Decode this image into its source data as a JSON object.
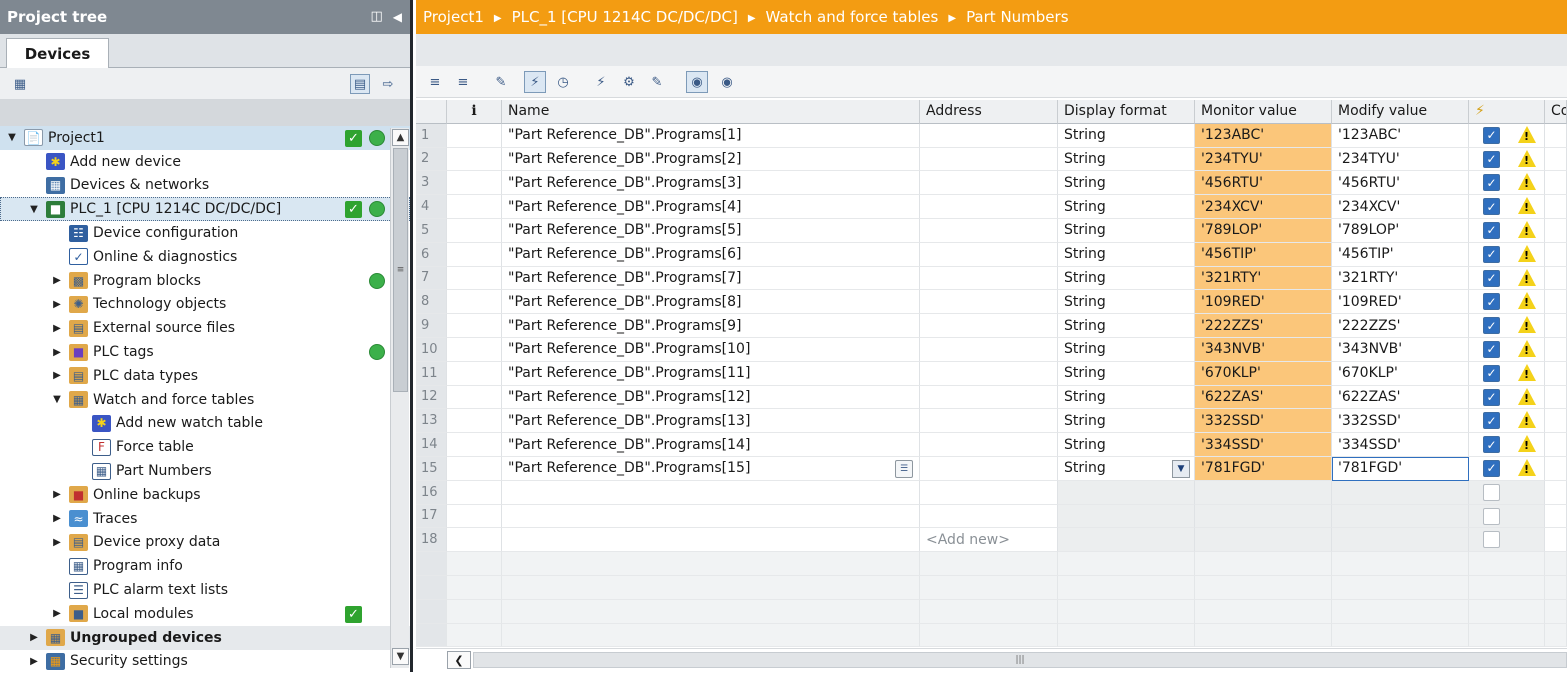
{
  "project_tree": {
    "title": "Project tree",
    "devices_tab": "Devices",
    "items": [
      {
        "label": "Project1",
        "level": 0,
        "expand": "open",
        "icon": "project-icon",
        "status_check": true,
        "status_dot": true,
        "style": "sel"
      },
      {
        "label": "Add new device",
        "level": 1,
        "expand": "",
        "icon": "add-device-icon"
      },
      {
        "label": "Devices & networks",
        "level": 1,
        "expand": "",
        "icon": "network-icon"
      },
      {
        "label": "PLC_1 [CPU 1214C DC/DC/DC]",
        "level": 1,
        "expand": "open",
        "icon": "plc-icon",
        "status_check": true,
        "status_dot": true,
        "style": "selbox"
      },
      {
        "label": "Device configuration",
        "level": 2,
        "expand": "",
        "icon": "device-config-icon"
      },
      {
        "label": "Online & diagnostics",
        "level": 2,
        "expand": "",
        "icon": "diagnostics-icon"
      },
      {
        "label": "Program blocks",
        "level": 2,
        "expand": "closed",
        "icon": "program-blocks-icon",
        "status_dot": true
      },
      {
        "label": "Technology objects",
        "level": 2,
        "expand": "closed",
        "icon": "technology-icon"
      },
      {
        "label": "External source files",
        "level": 2,
        "expand": "closed",
        "icon": "source-files-icon"
      },
      {
        "label": "PLC tags",
        "level": 2,
        "expand": "closed",
        "icon": "tags-icon",
        "status_dot": true
      },
      {
        "label": "PLC data types",
        "level": 2,
        "expand": "closed",
        "icon": "data-types-icon"
      },
      {
        "label": "Watch and force tables",
        "level": 2,
        "expand": "open",
        "icon": "watch-folder-icon"
      },
      {
        "label": "Add new watch table",
        "level": 3,
        "expand": "",
        "icon": "add-watch-icon"
      },
      {
        "label": "Force table",
        "level": 3,
        "expand": "",
        "icon": "force-table-icon"
      },
      {
        "label": "Part Numbers",
        "level": 3,
        "expand": "",
        "icon": "watch-table-icon"
      },
      {
        "label": "Online backups",
        "level": 2,
        "expand": "closed",
        "icon": "backup-icon"
      },
      {
        "label": "Traces",
        "level": 2,
        "expand": "closed",
        "icon": "traces-icon"
      },
      {
        "label": "Device proxy data",
        "level": 2,
        "expand": "closed",
        "icon": "proxy-icon"
      },
      {
        "label": "Program info",
        "level": 2,
        "expand": "",
        "icon": "program-info-icon"
      },
      {
        "label": "PLC alarm text lists",
        "level": 2,
        "expand": "",
        "icon": "alarm-text-icon"
      },
      {
        "label": "Local modules",
        "level": 2,
        "expand": "closed",
        "icon": "modules-icon",
        "status_check": true
      },
      {
        "label": "Ungrouped devices",
        "level": 1,
        "expand": "closed",
        "icon": "ungrouped-icon",
        "style": "grp"
      },
      {
        "label": "Security settings",
        "level": 1,
        "expand": "closed",
        "icon": "security-icon"
      }
    ]
  },
  "breadcrumb": [
    "Project1",
    "PLC_1 [CPU 1214C DC/DC/DC]",
    "Watch and force tables",
    "Part Numbers"
  ],
  "table": {
    "columns": {
      "info": "i",
      "name": "Name",
      "address": "Address",
      "display_format": "Display format",
      "monitor_value": "Monitor value",
      "modify_value": "Modify value",
      "comment": "Co"
    },
    "rows": [
      {
        "num": "1",
        "name": "\"Part Reference_DB\".Programs[1]",
        "format": "String",
        "monitor": "'123ABC'",
        "modify": "'123ABC'"
      },
      {
        "num": "2",
        "name": "\"Part Reference_DB\".Programs[2]",
        "format": "String",
        "monitor": "'234TYU'",
        "modify": "'234TYU'"
      },
      {
        "num": "3",
        "name": "\"Part Reference_DB\".Programs[3]",
        "format": "String",
        "monitor": "'456RTU'",
        "modify": "'456RTU'"
      },
      {
        "num": "4",
        "name": "\"Part Reference_DB\".Programs[4]",
        "format": "String",
        "monitor": "'234XCV'",
        "modify": "'234XCV'"
      },
      {
        "num": "5",
        "name": "\"Part Reference_DB\".Programs[5]",
        "format": "String",
        "monitor": "'789LOP'",
        "modify": "'789LOP'"
      },
      {
        "num": "6",
        "name": "\"Part Reference_DB\".Programs[6]",
        "format": "String",
        "monitor": "'456TIP'",
        "modify": "'456TIP'"
      },
      {
        "num": "7",
        "name": "\"Part Reference_DB\".Programs[7]",
        "format": "String",
        "monitor": "'321RTY'",
        "modify": "'321RTY'"
      },
      {
        "num": "8",
        "name": "\"Part Reference_DB\".Programs[8]",
        "format": "String",
        "monitor": "'109RED'",
        "modify": "'109RED'"
      },
      {
        "num": "9",
        "name": "\"Part Reference_DB\".Programs[9]",
        "format": "String",
        "monitor": "'222ZZS'",
        "modify": "'222ZZS'"
      },
      {
        "num": "10",
        "name": "\"Part Reference_DB\".Programs[10]",
        "format": "String",
        "monitor": "'343NVB'",
        "modify": "'343NVB'"
      },
      {
        "num": "11",
        "name": "\"Part Reference_DB\".Programs[11]",
        "format": "String",
        "monitor": "'670KLP'",
        "modify": "'670KLP'"
      },
      {
        "num": "12",
        "name": "\"Part Reference_DB\".Programs[12]",
        "format": "String",
        "monitor": "'622ZAS'",
        "modify": "'622ZAS'"
      },
      {
        "num": "13",
        "name": "\"Part Reference_DB\".Programs[13]",
        "format": "String",
        "monitor": "'332SSD'",
        "modify": "'332SSD'"
      },
      {
        "num": "14",
        "name": "\"Part Reference_DB\".Programs[14]",
        "format": "String",
        "monitor": "'334SSD'",
        "modify": "'334SSD'"
      },
      {
        "num": "15",
        "name": "\"Part Reference_DB\".Programs[15]",
        "format": "String",
        "monitor": "'781FGD'",
        "modify": "'781FGD'",
        "editing": true
      }
    ],
    "empty_rows": [
      "16",
      "17",
      "18"
    ],
    "add_new": "<Add new>"
  },
  "colors": {
    "breadcrumb": "#f39c12",
    "monitor_highlight": "#fbc67a",
    "status_ok": "#3cb04a",
    "header_gray": "#7f8891"
  }
}
